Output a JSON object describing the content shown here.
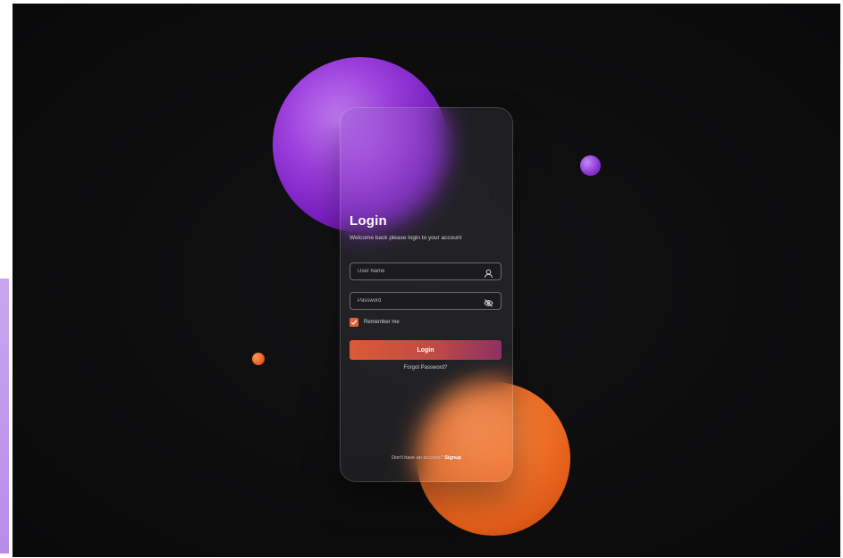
{
  "login": {
    "title": "Login",
    "subtitle": "Welcome back please login to your account",
    "username": {
      "placeholder": "User Name",
      "value": "",
      "icon": "user-icon"
    },
    "password": {
      "placeholder": "Password",
      "value": "",
      "icon": "eye-off-icon"
    },
    "remember_me": {
      "label": "Remember me",
      "checked": true
    },
    "login_button_label": "Login",
    "forgot_password_label": "Forgot Password?",
    "signup_prompt": "Don't have an account?",
    "signup_link_label": "Signup"
  },
  "colors": {
    "background": "#0d0d0e",
    "accent_orange": "#e0613a",
    "accent_purple": "#9c3fdc",
    "button_gradient_start": "#d95b35",
    "button_gradient_end": "#8d3163"
  }
}
